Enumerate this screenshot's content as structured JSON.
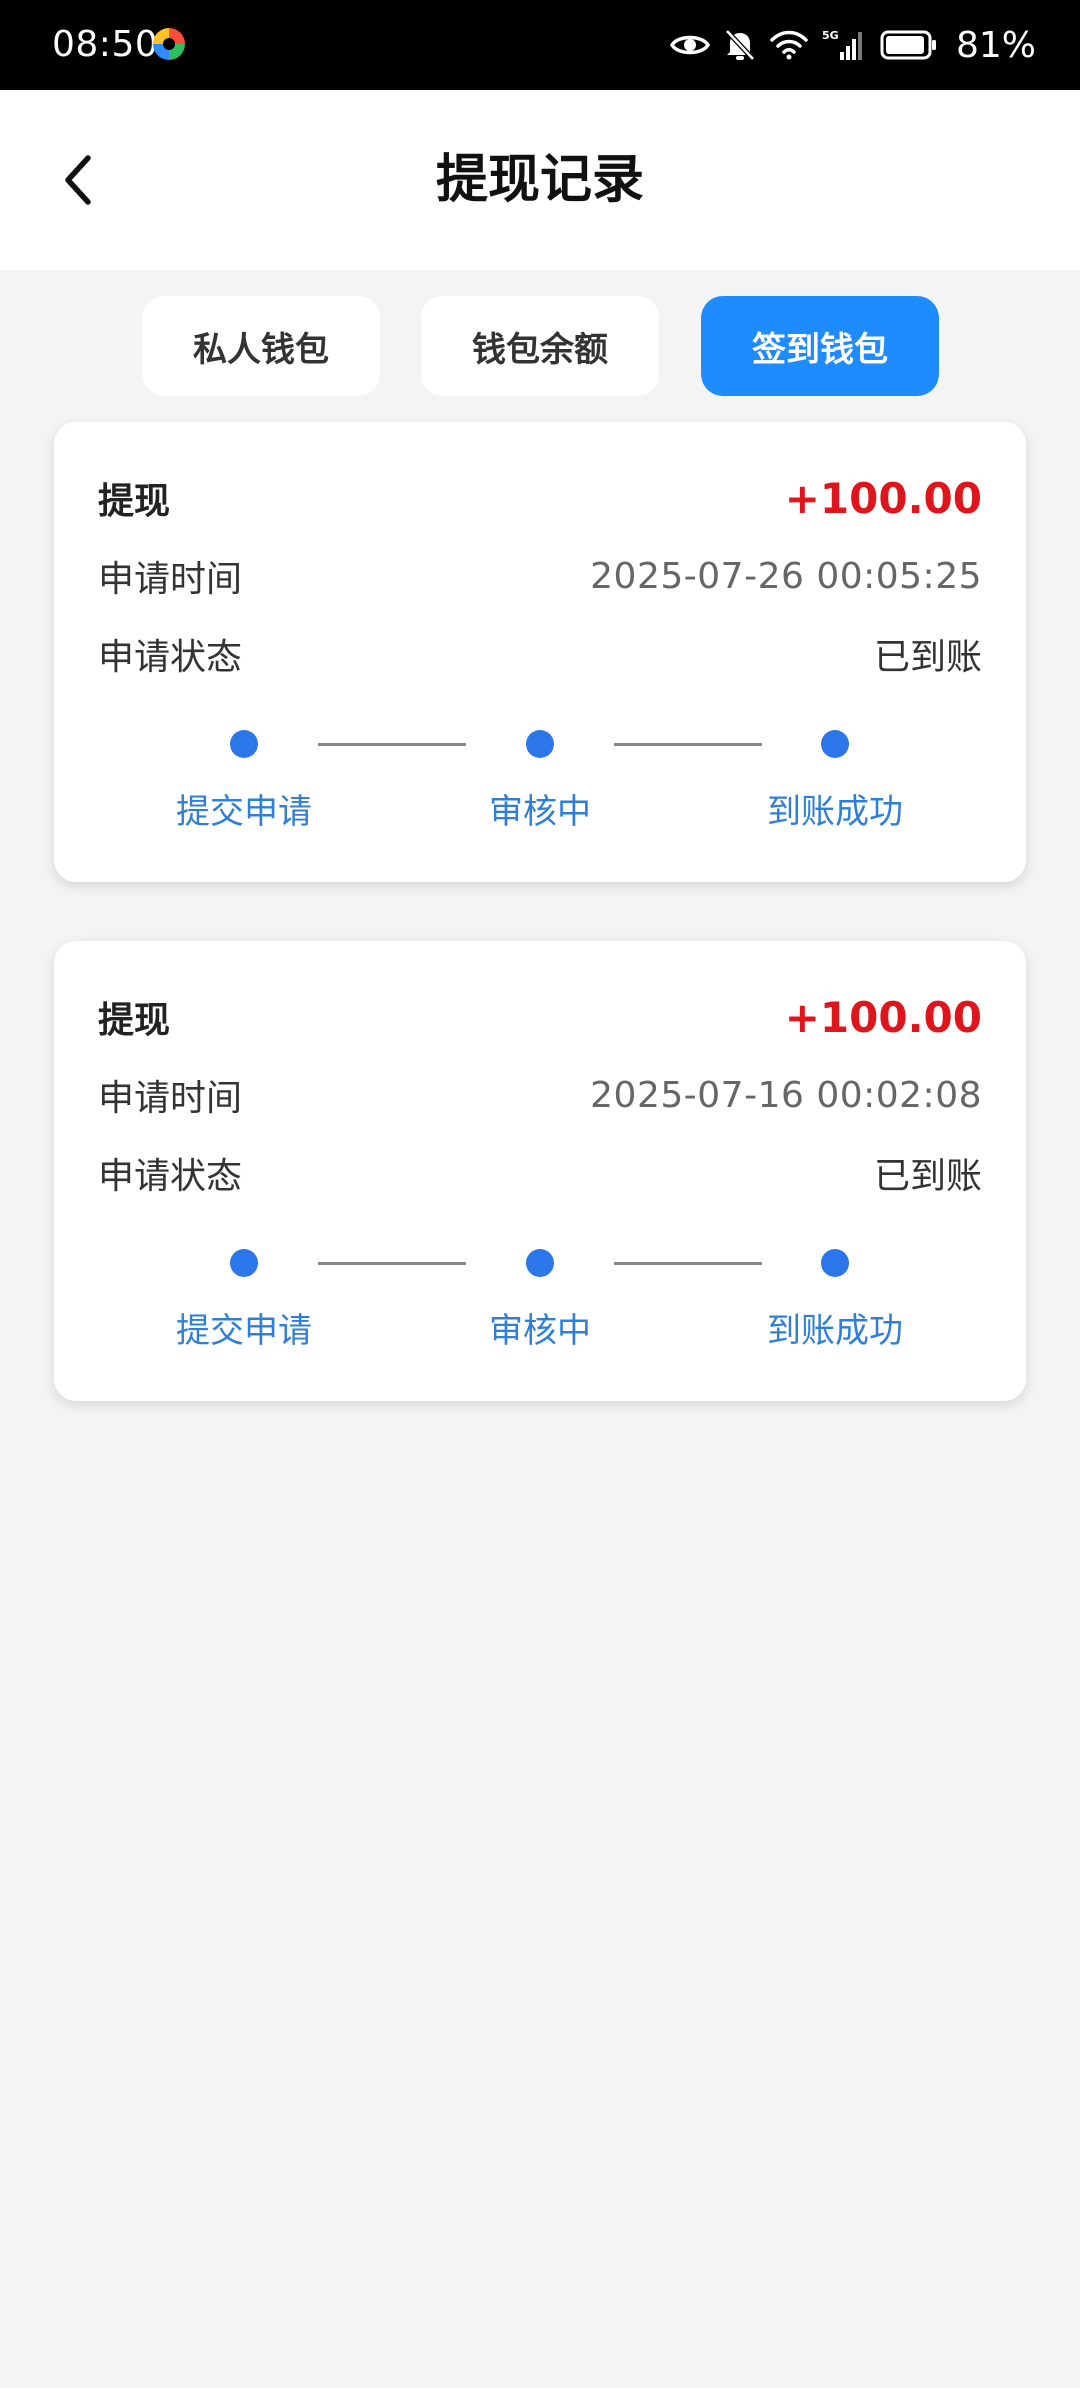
{
  "status_bar": {
    "time": "08:50",
    "battery_percent": "81%",
    "icons": [
      "app-badge-icon",
      "eye-icon",
      "mute-bell-icon",
      "wifi-icon",
      "signal-5g-icon",
      "battery-icon"
    ]
  },
  "header": {
    "title": "提现记录",
    "back_icon": "chevron-left-icon"
  },
  "tabs": [
    {
      "label": "私人钱包",
      "active": false
    },
    {
      "label": "钱包余额",
      "active": false
    },
    {
      "label": "签到钱包",
      "active": true
    }
  ],
  "records": [
    {
      "type": "提现",
      "amount": "+100.00",
      "time_label": "申请时间",
      "time": "2025-07-26 00:05:25",
      "status_label": "申请状态",
      "status": "已到账",
      "steps": [
        "提交申请",
        "审核中",
        "到账成功"
      ]
    },
    {
      "type": "提现",
      "amount": "+100.00",
      "time_label": "申请时间",
      "time": "2025-07-16 00:02:08",
      "status_label": "申请状态",
      "status": "已到账",
      "steps": [
        "提交申请",
        "审核中",
        "到账成功"
      ]
    }
  ],
  "colors": {
    "accent": "#1e8cff",
    "amount_red": "#e0141b",
    "step_blue": "#2b76e8",
    "background": "#f4f4f4"
  }
}
